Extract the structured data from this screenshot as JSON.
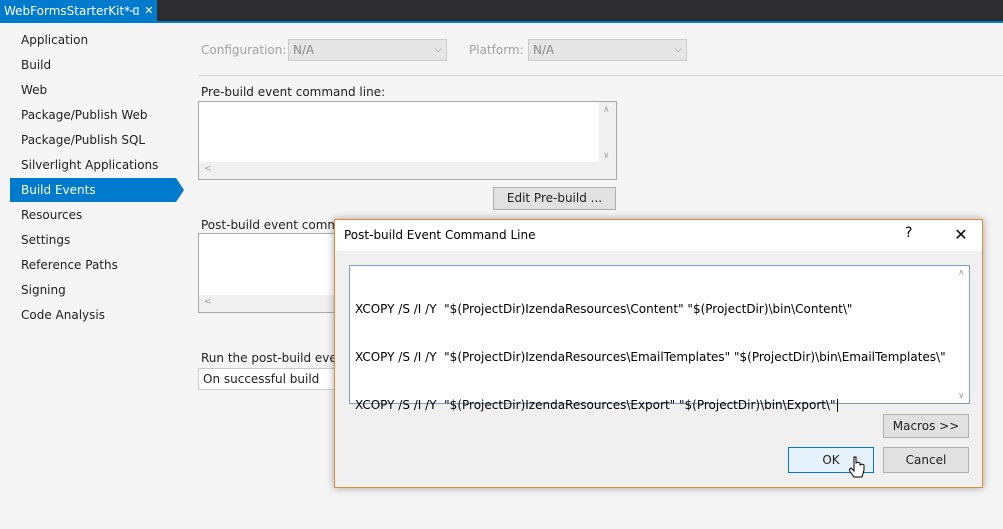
{
  "tab": {
    "title": "WebFormsStarterKit*",
    "pin": "⊕",
    "close": "✕"
  },
  "nav": {
    "items": [
      {
        "label": "Application"
      },
      {
        "label": "Build"
      },
      {
        "label": "Web"
      },
      {
        "label": "Package/Publish Web"
      },
      {
        "label": "Package/Publish SQL"
      },
      {
        "label": "Silverlight Applications"
      },
      {
        "label": "Build Events",
        "active": true
      },
      {
        "label": "Resources"
      },
      {
        "label": "Settings"
      },
      {
        "label": "Reference Paths"
      },
      {
        "label": "Signing"
      },
      {
        "label": "Code Analysis"
      }
    ]
  },
  "config": {
    "label": "Configuration:",
    "value": "N/A"
  },
  "platform": {
    "label": "Platform:",
    "value": "N/A"
  },
  "prebuild": {
    "label": "Pre-build event command line:",
    "edit_button": "Edit Pre-build ..."
  },
  "postbuild": {
    "label": "Post-build event comman"
  },
  "run": {
    "label": "Run the post-build event:",
    "value": "On successful build"
  },
  "dialog": {
    "title": "Post-build Event Command Line",
    "help": "?",
    "close": "✕",
    "lines": [
      "XCOPY /S /I /Y  \"$(ProjectDir)IzendaResources\\Content\" \"$(ProjectDir)\\bin\\Content\\\"",
      "XCOPY /S /I /Y  \"$(ProjectDir)IzendaResources\\EmailTemplates\" \"$(ProjectDir)\\bin\\EmailTemplates\\\"",
      "XCOPY /S /I /Y  \"$(ProjectDir)IzendaResources\\Export\" \"$(ProjectDir)\\bin\\Export\\\""
    ],
    "macros_button": "Macros >>",
    "ok_button": "OK",
    "cancel_button": "Cancel"
  },
  "colors": {
    "accent": "#007acc",
    "dialog_border": "#e38b2f",
    "focus": "#0078d7"
  }
}
